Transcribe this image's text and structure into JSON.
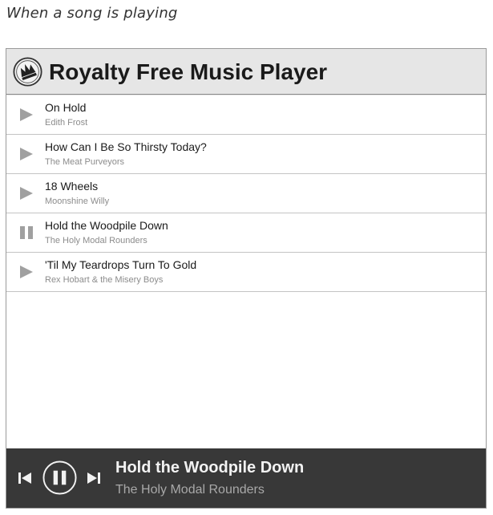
{
  "caption": "When a song is playing",
  "app": {
    "title": "Royalty Free Music Player",
    "logo_icon": "crown-badge-icon"
  },
  "colors": {
    "header_bg": "#e6e6e6",
    "footer_bg": "#383838",
    "icon_gray": "#a0a0a0"
  },
  "playlist": [
    {
      "title": "On Hold",
      "artist": "Edith Frost",
      "state": "stopped",
      "icon": "play-icon"
    },
    {
      "title": "How Can I Be So Thirsty Today?",
      "artist": "The Meat Purveyors",
      "state": "stopped",
      "icon": "play-icon"
    },
    {
      "title": "18 Wheels",
      "artist": "Moonshine Willy",
      "state": "stopped",
      "icon": "play-icon"
    },
    {
      "title": "Hold the Woodpile Down",
      "artist": "The Holy Modal Rounders",
      "state": "playing",
      "icon": "pause-icon"
    },
    {
      "title": "'Til My Teardrops Turn To Gold",
      "artist": "Rex Hobart & the Misery Boys",
      "state": "stopped",
      "icon": "play-icon"
    }
  ],
  "now_playing": {
    "title": "Hold the Woodpile Down",
    "artist": "The Holy Modal Rounders",
    "controls": [
      "previous-icon",
      "pause-icon",
      "next-icon"
    ]
  }
}
